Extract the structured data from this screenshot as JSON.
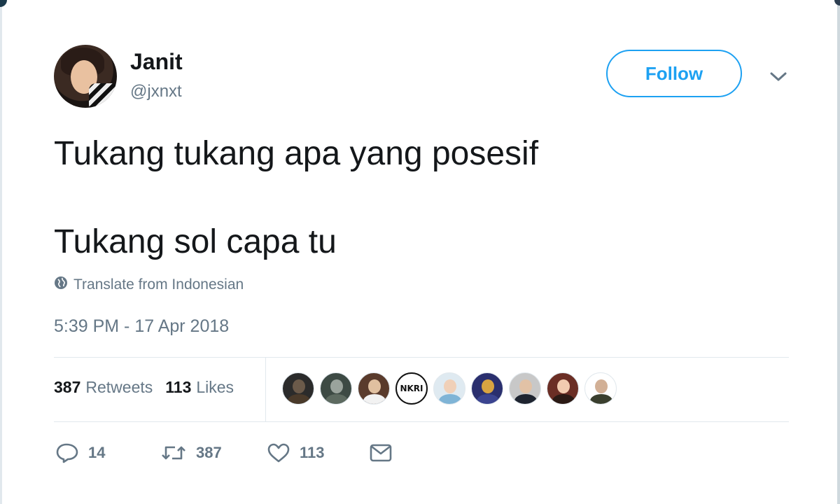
{
  "user": {
    "display_name": "Janit",
    "handle": "@jxnxt"
  },
  "follow_button": {
    "label": "Follow"
  },
  "tweet": {
    "line1": "Tukang tukang apa yang posesif",
    "line2": "Tukang sol capa tu",
    "translate_label": "Translate from Indonesian",
    "timestamp": "5:39 PM - 17 Apr 2018"
  },
  "stats": {
    "retweets_count": "387",
    "retweets_label": "Retweets",
    "likes_count": "113",
    "likes_label": "Likes"
  },
  "likers": {
    "count": 9,
    "nkri_badge_text": "NKRI"
  },
  "actions": {
    "reply_count": "14",
    "retweet_count": "387",
    "like_count": "113"
  },
  "colors": {
    "accent": "#1da1f2",
    "muted_text": "#657786",
    "primary_text": "#14171a",
    "divider": "#e1e8ed"
  }
}
